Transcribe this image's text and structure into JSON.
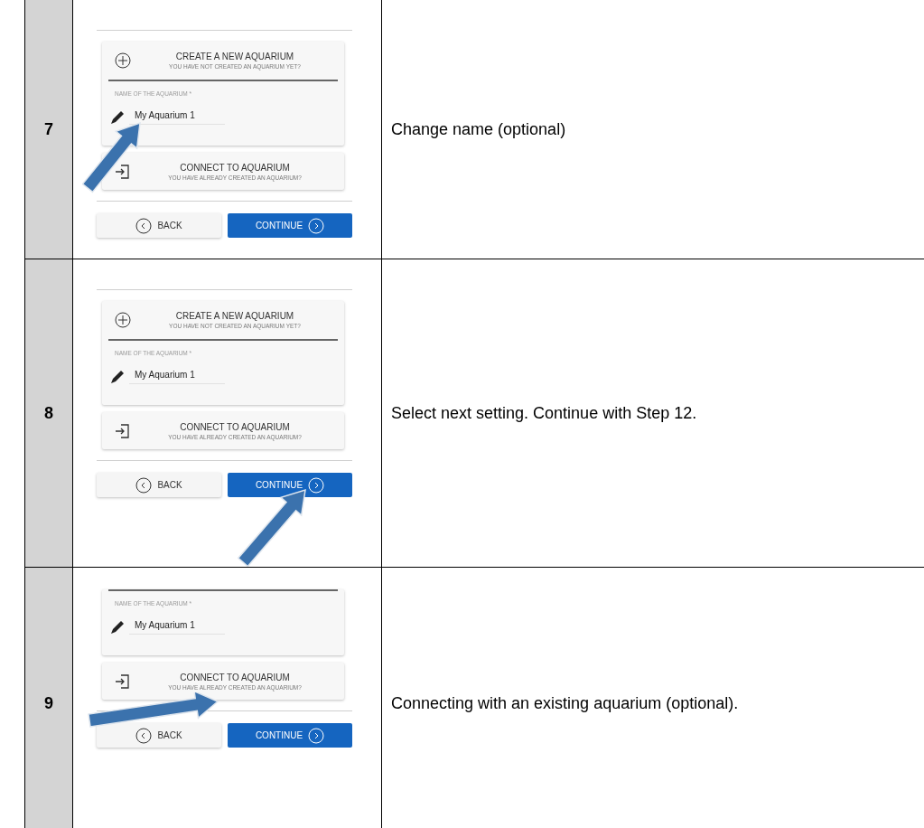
{
  "steps": [
    {
      "number": "7",
      "screen": {
        "create": {
          "title": "CREATE A NEW AQUARIUM",
          "subtitle": "YOU HAVE NOT CREATED AN AQUARIUM YET?"
        },
        "field": {
          "label": "NAME OF THE AQUARIUM *",
          "value": "My Aquarium 1",
          "pointed": true
        },
        "connect": {
          "title": "CONNECT TO AQUARIUM",
          "subtitle": "YOU HAVE ALREADY CREATED AN AQUARIUM?"
        },
        "back": "BACK",
        "continue": {
          "label": "CONTINUE"
        }
      },
      "description": "Change name (optional)"
    },
    {
      "number": "8",
      "screen": {
        "create": {
          "title": "CREATE A NEW AQUARIUM",
          "subtitle": "YOU HAVE NOT CREATED AN AQUARIUM YET?"
        },
        "field": {
          "label": "NAME OF THE AQUARIUM *",
          "value": "My Aquarium 1"
        },
        "connect": {
          "title": "CONNECT TO AQUARIUM",
          "subtitle": "YOU HAVE ALREADY CREATED AN AQUARIUM?"
        },
        "back": "BACK",
        "continue": {
          "label": "CONTINUE",
          "pointed": true
        }
      },
      "description": "Select next setting. Continue with Step 12."
    },
    {
      "number": "9",
      "screen": {
        "field": {
          "label": "NAME OF THE AQUARIUM *",
          "value": "My Aquarium 1"
        },
        "connect": {
          "title": "CONNECT TO AQUARIUM",
          "subtitle": "YOU HAVE ALREADY CREATED AN AQUARIUM?",
          "pointed": true
        },
        "back": "BACK",
        "continue": {
          "label": "CONTINUE"
        }
      },
      "description": "Connecting with an existing aquarium (optional)."
    }
  ]
}
